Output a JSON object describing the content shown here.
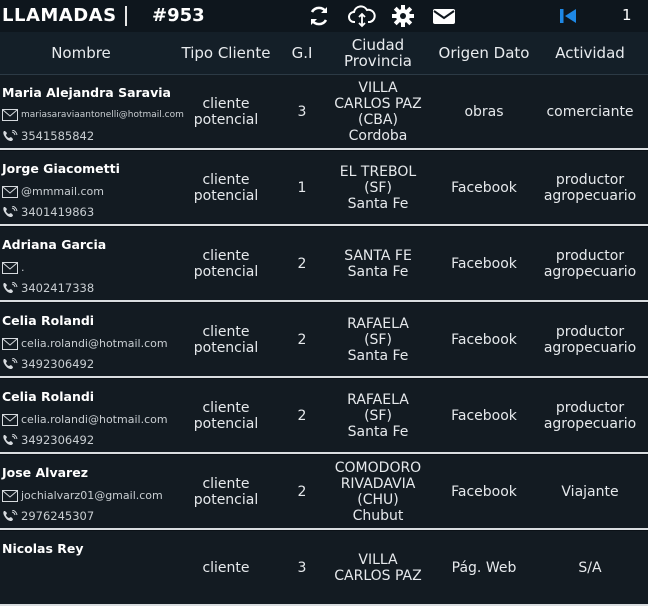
{
  "topbar": {
    "title": "LLAMADAS",
    "call_number": "#953",
    "page_count": "1",
    "icons": [
      "refresh-icon",
      "cloud-sync-icon",
      "gear-icon",
      "mail-icon",
      "first-page-icon"
    ],
    "accent": "#1e88e5"
  },
  "columns": {
    "nombre": "Nombre",
    "tipo": "Tipo Cliente",
    "gi": "G.I",
    "ciudad": "Ciudad",
    "provincia": "Provincia",
    "origen": "Origen Dato",
    "actividad": "Actividad"
  },
  "rows": [
    {
      "name": "Maria Alejandra Saravia",
      "email": "mariasaraviaantonelli@hotmail.com",
      "phone": "3541585842",
      "tipo": [
        "cliente",
        "potencial"
      ],
      "gi": "3",
      "ciudad": [
        "VILLA",
        "CARLOS PAZ",
        "(CBA)"
      ],
      "provincia": "Cordoba",
      "origen": "obras",
      "actividad": [
        "comerciante"
      ]
    },
    {
      "name": "Jorge Giacometti",
      "email": "@mmmail.com",
      "phone": "3401419863",
      "tipo": [
        "cliente",
        "potencial"
      ],
      "gi": "1",
      "ciudad": [
        "EL TREBOL",
        "(SF)"
      ],
      "provincia": "Santa Fe",
      "origen": "Facebook",
      "actividad": [
        "productor",
        "agropecuario"
      ]
    },
    {
      "name": "Adriana Garcia",
      "email": ".",
      "phone": "3402417338",
      "tipo": [
        "cliente",
        "potencial"
      ],
      "gi": "2",
      "ciudad": [
        "SANTA FE"
      ],
      "provincia": "Santa Fe",
      "origen": "Facebook",
      "actividad": [
        "productor",
        "agropecuario"
      ]
    },
    {
      "name": "Celia Rolandi",
      "email": "celia.rolandi@hotmail.com",
      "phone": "3492306492",
      "tipo": [
        "cliente",
        "potencial"
      ],
      "gi": "2",
      "ciudad": [
        "RAFAELA",
        "(SF)"
      ],
      "provincia": "Santa Fe",
      "origen": "Facebook",
      "actividad": [
        "productor",
        "agropecuario"
      ]
    },
    {
      "name": "Celia Rolandi",
      "email": "celia.rolandi@hotmail.com",
      "phone": "3492306492",
      "tipo": [
        "cliente",
        "potencial"
      ],
      "gi": "2",
      "ciudad": [
        "RAFAELA",
        "(SF)"
      ],
      "provincia": "Santa Fe",
      "origen": "Facebook",
      "actividad": [
        "productor",
        "agropecuario"
      ]
    },
    {
      "name": "Jose Alvarez",
      "email": "jochialvarz01@gmail.com",
      "phone": "2976245307",
      "tipo": [
        "cliente",
        "potencial"
      ],
      "gi": "2",
      "ciudad": [
        "COMODORO",
        "RIVADAVIA",
        "(CHU)"
      ],
      "provincia": "Chubut",
      "origen": "Facebook",
      "actividad": [
        "Viajante"
      ]
    },
    {
      "name": "Nicolas Rey",
      "email": "",
      "phone": "",
      "tipo": [
        "cliente"
      ],
      "gi": "3",
      "ciudad": [
        "VILLA",
        "CARLOS PAZ"
      ],
      "provincia": "",
      "origen": "Pág. Web",
      "actividad": [
        "S/A"
      ]
    }
  ]
}
